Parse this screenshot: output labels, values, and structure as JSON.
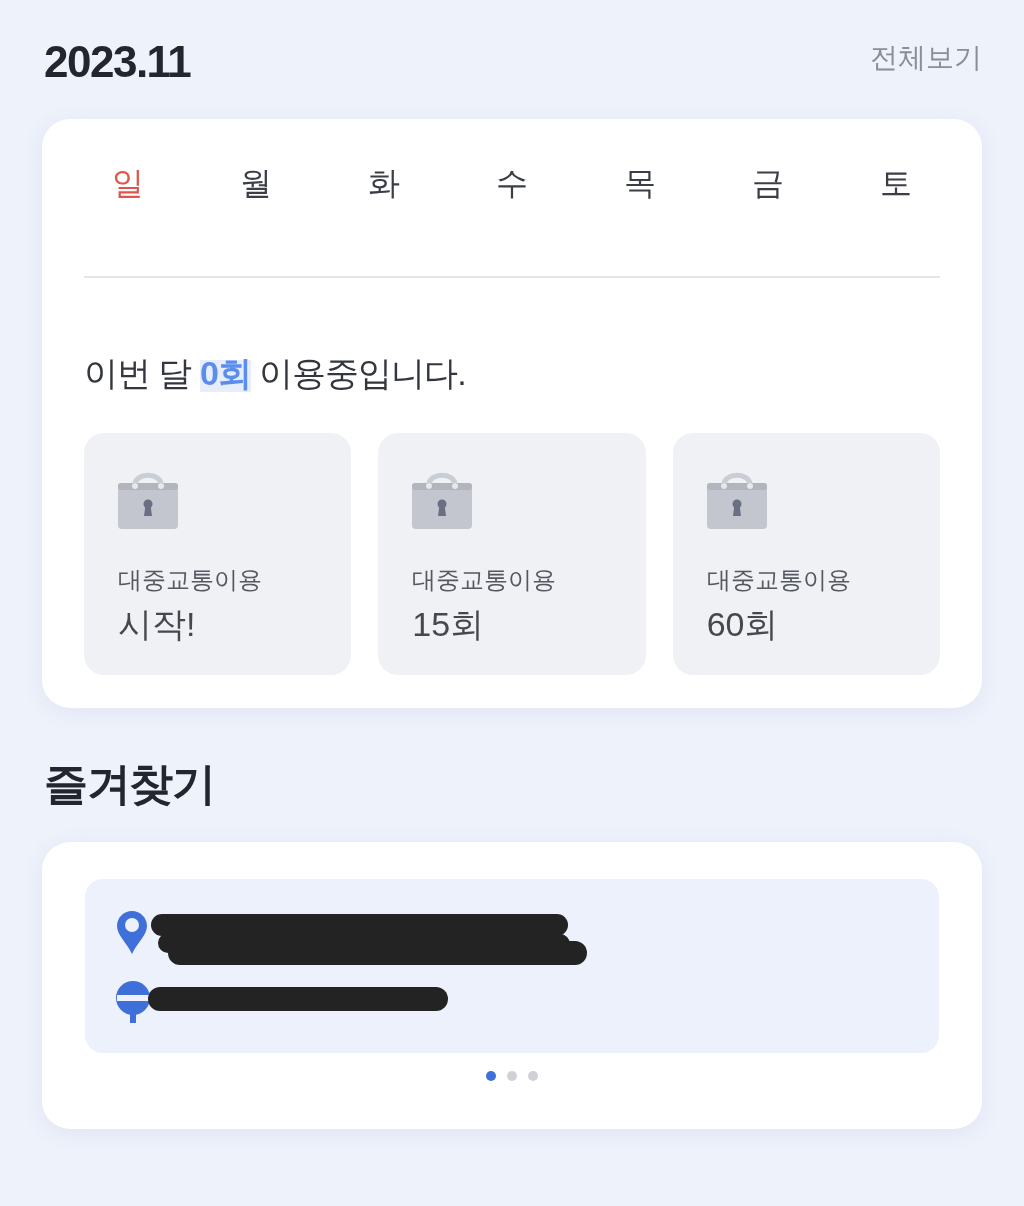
{
  "header": {
    "title": "2023.11",
    "view_all_link": "전체보기"
  },
  "calendar": {
    "weekdays": [
      {
        "label": "일",
        "color": "#e0564c"
      },
      {
        "label": "월",
        "color": "#3b3e46"
      },
      {
        "label": "화",
        "color": "#3b3e46"
      },
      {
        "label": "수",
        "color": "#3b3e46"
      },
      {
        "label": "목",
        "color": "#3b3e46"
      },
      {
        "label": "금",
        "color": "#3b3e46"
      },
      {
        "label": "토",
        "color": "#3b3e46"
      }
    ],
    "summary": "이번 달 **0회** 이용중입니다.",
    "badges": [
      {
        "title": "대중교통이용",
        "value": "시작!",
        "locked": true
      },
      {
        "title": "대중교통이용",
        "value": "15회",
        "locked": true
      },
      {
        "title": "대중교통이용",
        "value": "60회",
        "locked": true
      }
    ]
  },
  "favorites": {
    "title": "즐겨찾기",
    "routes": [
      {
        "kind": "place"
      },
      {
        "kind": "stop"
      }
    ],
    "pager": [
      {
        "selected": true
      },
      {
        "selected": false
      },
      {
        "selected": false
      }
    ]
  }
}
